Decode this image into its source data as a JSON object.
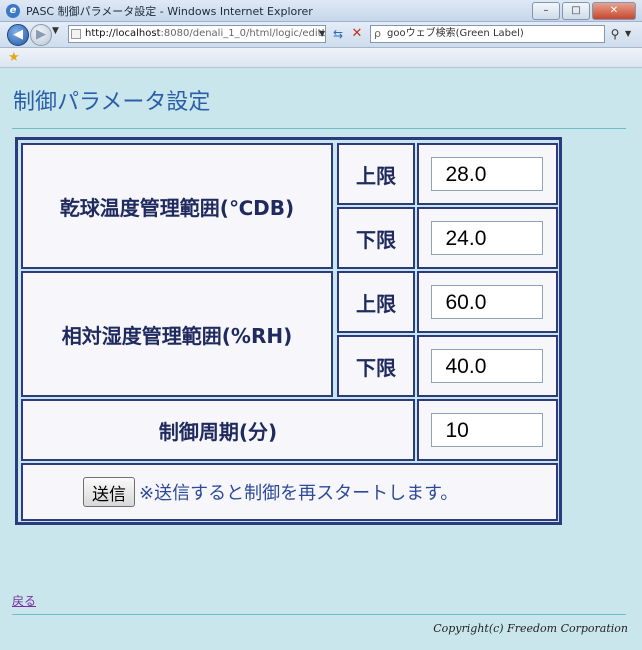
{
  "window": {
    "title": "PASC 制御パラメータ設定 - Windows Internet Explorer",
    "icon": "ie-icon",
    "controls": [
      "minimize",
      "maximize",
      "close"
    ]
  },
  "navbar": {
    "url_host": "http://localhost",
    "url_rest": ":8080/denali_1_0/html/logic/editLo",
    "search_placeholder": "gooウェブ検索(Green Label)"
  },
  "page": {
    "title": "制御パラメータ設定",
    "rows": {
      "drybulb": {
        "label": "乾球温度管理範囲(℃DB)",
        "upper_label": "上限",
        "upper_value": "28.0",
        "lower_label": "下限",
        "lower_value": "24.0"
      },
      "humidity": {
        "label": "相対湿度管理範囲(%RH)",
        "upper_label": "上限",
        "upper_value": "60.0",
        "lower_label": "下限",
        "lower_value": "40.0"
      },
      "period": {
        "label": "制御周期(分)",
        "value": "10"
      }
    },
    "submit_label": "送信",
    "submit_note": "※送信すると制御を再スタートします。",
    "back_link": "戻る",
    "copyright": "Copyright(c) Freedom Corporation"
  },
  "colors": {
    "page_bg": "#c9e6ec",
    "title": "#2a5fa8",
    "table_border": "#2c3b7e",
    "note": "#2d4a9a",
    "rule": "#6bbfc8"
  }
}
